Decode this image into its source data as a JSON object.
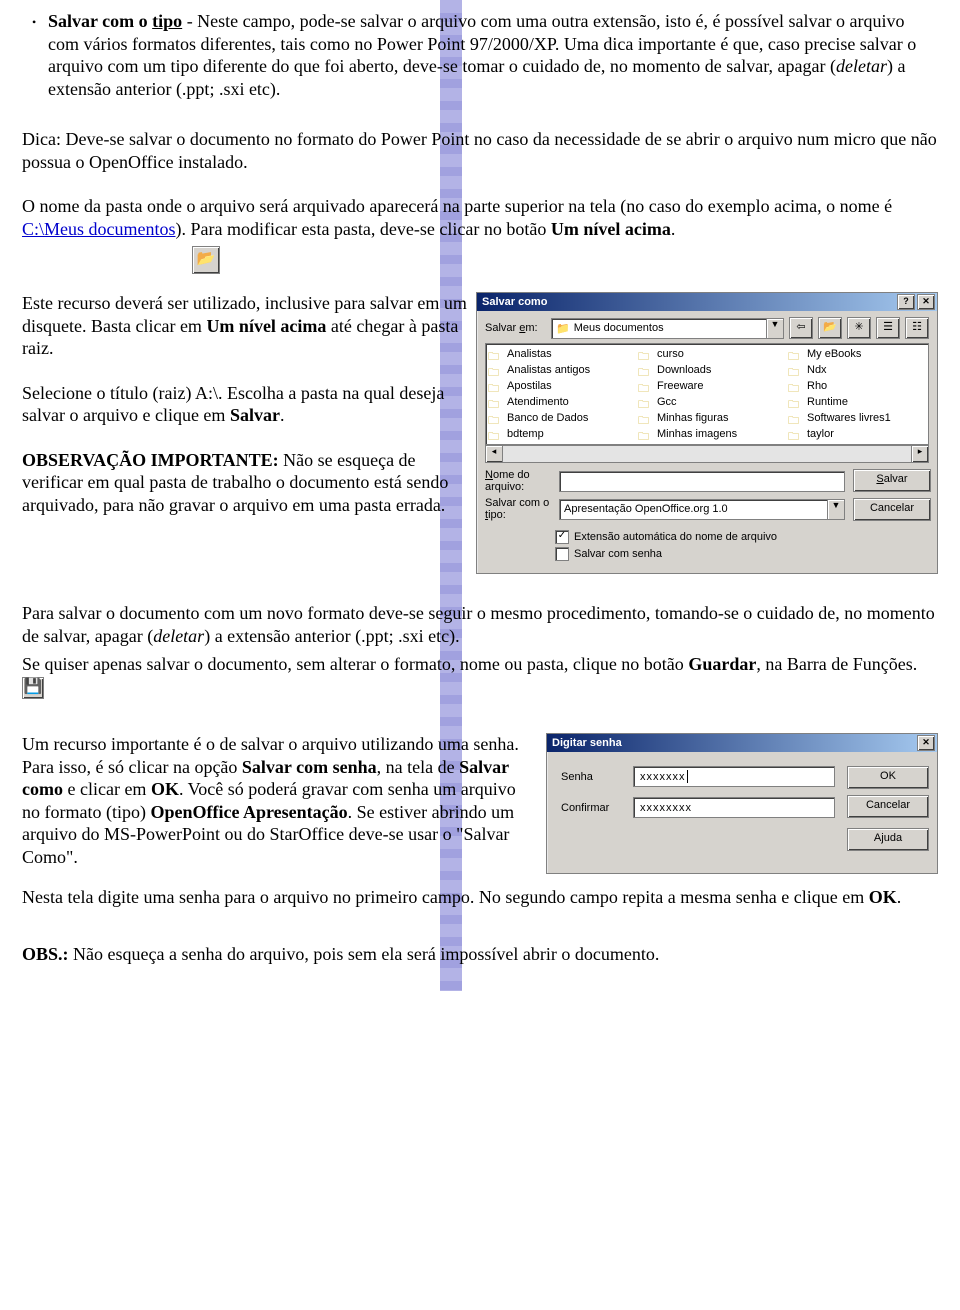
{
  "doc": {
    "bullet_lead": "Salvar com o ",
    "bullet_tipo": "tipo",
    "para1_rest": " - Neste campo, pode-se salvar o arquivo com uma outra extensão, isto é, é possível salvar o arquivo com vários formatos diferentes, tais como no Power Point 97/2000/XP. Uma dica importante é que, caso precise salvar o arquivo com um tipo diferente do que foi aberto, deve-se tomar o cuidado de, no momento de salvar, apagar (",
    "deletar": "deletar",
    "para1_tail": ") a extensão anterior (.ppt; .sxi etc).",
    "para2": "Dica: Deve-se salvar o documento no formato do Power Point no caso da necessidade de se abrir o arquivo num micro que não possua o OpenOffice instalado.",
    "para3_a": "O nome da pasta onde o arquivo será arquivado aparecerá na parte superior na tela (no caso do exemplo acima, o nome é ",
    "para3_link": "C:\\Meus documentos",
    "para3_b": "). Para modificar esta pasta, deve-se clicar no botão  ",
    "para3_bold": "Um nível acima",
    "para3_c": ".",
    "para4_a": "Este recurso deverá ser utilizado, inclusive para salvar em um disquete. Basta clicar em  ",
    "para4_bold": "Um nível acima",
    "para4_b": " até chegar à pasta raiz.",
    "para5_a": "Selecione o título (raiz) A:\\.  Escolha a pasta na qual deseja salvar o arquivo e clique em ",
    "para5_bold": "Salvar",
    "para5_b": ".",
    "para6_bold": "OBSERVAÇÃO IMPORTANTE:",
    "para6_rest": " Não se esqueça de verificar em qual pasta de trabalho o documento está sendo arquivado, para não gravar o arquivo em uma pasta errada.",
    "para7_a": "Para salvar o documento com um novo formato deve-se seguir o mesmo procedimento, tomando-se o cuidado de, no momento de salvar, apagar (",
    "para7_b": ") a extensão anterior (.ppt; .sxi etc).",
    "para8_a": "Se quiser apenas salvar o documento, sem alterar o formato, nome ou pasta, clique no botão ",
    "para8_bold": "Guardar",
    "para8_b": ", na Barra de Funções. ",
    "para9_a": "Um recurso importante é o de salvar o arquivo utilizando uma senha. Para isso, é só clicar na opção  ",
    "para9_bold1": "Salvar com senha",
    "para9_b": ", na tela de ",
    "para9_bold2": "Salvar como",
    "para9_c": " e clicar em ",
    "para9_bold3": "OK",
    "para9_d": ". Você só poderá gravar com senha um arquivo no formato (tipo) ",
    "para9_bold4": "OpenOffice Apresentação",
    "para9_e": ". Se estiver abrindo um arquivo do MS-PowerPoint ou do StarOffice deve-se usar o \"Salvar Como\".",
    "para10_a": "Nesta tela digite uma senha para o arquivo no primeiro campo. No segundo campo repita a mesma senha e clique em ",
    "para10_bold": "OK",
    "para10_b": ".",
    "obs_lead": "OBS.:",
    "obs_rest": "  Não esqueça a senha do arquivo, pois sem ela será impossível abrir o documento."
  },
  "save_dialog": {
    "title": "Salvar como",
    "salvar_em_lbl": "Salvar em:",
    "salvar_em_u": "e",
    "salvar_em_val": "Meus documentos",
    "folders_col1": [
      "Analistas",
      "Analistas antigos",
      "Apostilas",
      "Atendimento",
      "Banco de Dados",
      "bdtemp"
    ],
    "folders_col2": [
      "curso",
      "Downloads",
      "Freeware",
      "Gcc",
      "Minhas figuras",
      "Minhas imagens"
    ],
    "folders_col3": [
      "My eBooks",
      "Ndx",
      "Rho",
      "Runtime",
      "Softwares livres1",
      "taylor"
    ],
    "nome_lbl_1": "Nome do",
    "nome_u": "N",
    "nome_lbl_2": "arquivo:",
    "tipo_lbl_1": "Salvar com o",
    "tipo_u": "t",
    "tipo_lbl_2": "ipo:",
    "tipo_val": "Apresentação OpenOffice.org 1.0",
    "btn_salvar": "Salvar",
    "btn_salvar_u": "S",
    "btn_cancelar": "Cancelar",
    "chk1": "Extensão automática do nome de arquivo",
    "chk2": "Salvar com senha"
  },
  "pw_dialog": {
    "title": "Digitar senha",
    "senha_lbl": "Senha",
    "confirmar_lbl": "Confirmar",
    "masked1": "xxxxxxx",
    "masked2": "xxxxxxxx",
    "ok": "OK",
    "cancel": "Cancelar",
    "help": "Ajuda"
  }
}
